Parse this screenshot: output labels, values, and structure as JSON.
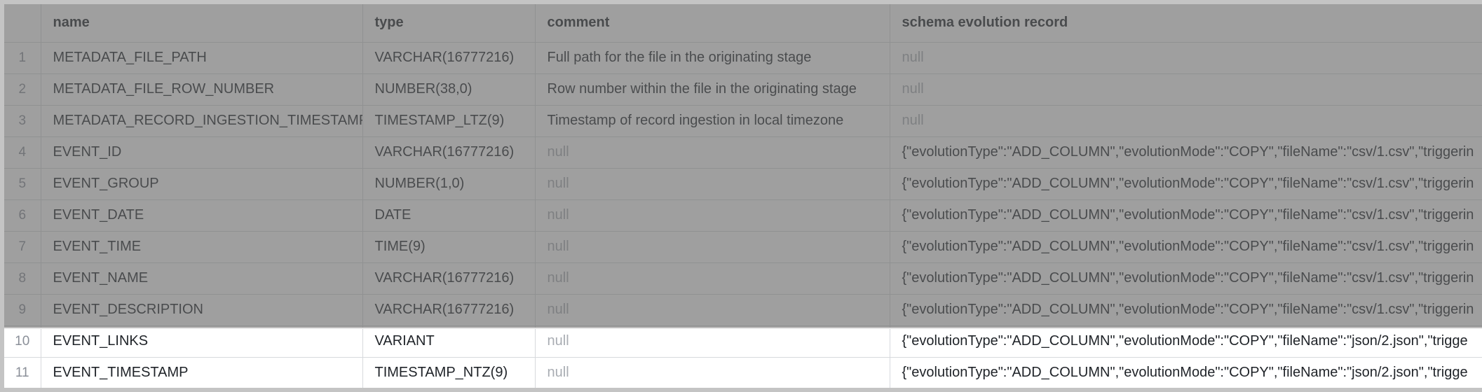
{
  "columns": [
    "name",
    "type",
    "comment",
    "schema evolution record"
  ],
  "rows": [
    {
      "index": "1",
      "name": "METADATA_FILE_PATH",
      "type": "VARCHAR(16777216)",
      "comment": "Full path for the file in the originating stage",
      "record": "null",
      "comment_null": false,
      "record_null": true
    },
    {
      "index": "2",
      "name": "METADATA_FILE_ROW_NUMBER",
      "type": "NUMBER(38,0)",
      "comment": "Row number within the file in the originating stage",
      "record": "null",
      "comment_null": false,
      "record_null": true
    },
    {
      "index": "3",
      "name": "METADATA_RECORD_INGESTION_TIMESTAMP",
      "type": "TIMESTAMP_LTZ(9)",
      "comment": "Timestamp of record ingestion in local timezone",
      "record": "null",
      "comment_null": false,
      "record_null": true
    },
    {
      "index": "4",
      "name": "EVENT_ID",
      "type": "VARCHAR(16777216)",
      "comment": "null",
      "record": "{\"evolutionType\":\"ADD_COLUMN\",\"evolutionMode\":\"COPY\",\"fileName\":\"csv/1.csv\",\"triggerin",
      "comment_null": true,
      "record_null": false
    },
    {
      "index": "5",
      "name": "EVENT_GROUP",
      "type": "NUMBER(1,0)",
      "comment": "null",
      "record": "{\"evolutionType\":\"ADD_COLUMN\",\"evolutionMode\":\"COPY\",\"fileName\":\"csv/1.csv\",\"triggerin",
      "comment_null": true,
      "record_null": false
    },
    {
      "index": "6",
      "name": "EVENT_DATE",
      "type": "DATE",
      "comment": "null",
      "record": "{\"evolutionType\":\"ADD_COLUMN\",\"evolutionMode\":\"COPY\",\"fileName\":\"csv/1.csv\",\"triggerin",
      "comment_null": true,
      "record_null": false
    },
    {
      "index": "7",
      "name": "EVENT_TIME",
      "type": "TIME(9)",
      "comment": "null",
      "record": "{\"evolutionType\":\"ADD_COLUMN\",\"evolutionMode\":\"COPY\",\"fileName\":\"csv/1.csv\",\"triggerin",
      "comment_null": true,
      "record_null": false
    },
    {
      "index": "8",
      "name": "EVENT_NAME",
      "type": "VARCHAR(16777216)",
      "comment": "null",
      "record": "{\"evolutionType\":\"ADD_COLUMN\",\"evolutionMode\":\"COPY\",\"fileName\":\"csv/1.csv\",\"triggerin",
      "comment_null": true,
      "record_null": false
    },
    {
      "index": "9",
      "name": "EVENT_DESCRIPTION",
      "type": "VARCHAR(16777216)",
      "comment": "null",
      "record": "{\"evolutionType\":\"ADD_COLUMN\",\"evolutionMode\":\"COPY\",\"fileName\":\"csv/1.csv\",\"triggerin",
      "comment_null": true,
      "record_null": false
    },
    {
      "index": "10",
      "name": "EVENT_LINKS",
      "type": "VARIANT",
      "comment": "null",
      "record": "{\"evolutionType\":\"ADD_COLUMN\",\"evolutionMode\":\"COPY\",\"fileName\":\"json/2.json\",\"trigge",
      "comment_null": true,
      "record_null": false
    },
    {
      "index": "11",
      "name": "EVENT_TIMESTAMP",
      "type": "TIMESTAMP_NTZ(9)",
      "comment": "null",
      "record": "{\"evolutionType\":\"ADD_COLUMN\",\"evolutionMode\":\"COPY\",\"fileName\":\"json/2.json\",\"trigge",
      "comment_null": true,
      "record_null": false
    }
  ],
  "colors": {
    "dim_overlay": "#646464",
    "border": "#c4c4c4",
    "null_text": "#a9adb3",
    "index_text": "#8a8f98"
  }
}
